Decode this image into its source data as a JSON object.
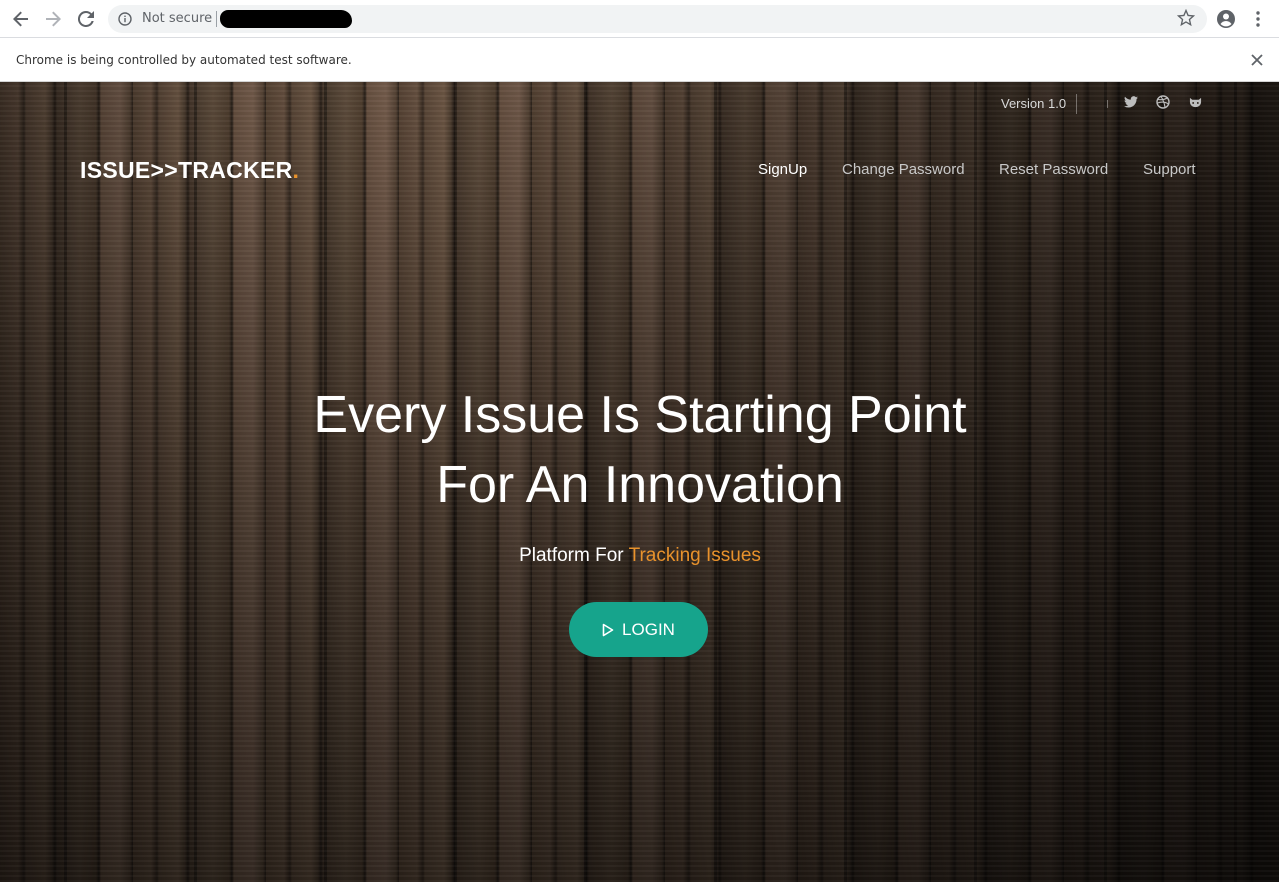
{
  "browser": {
    "not_secure_label": "Not secure",
    "infobar_text": "Chrome is being controlled by automated test software."
  },
  "site": {
    "version_label": "Version 1.0",
    "logo_text": "ISSUE>>TRACKER",
    "logo_dot": ".",
    "nav": [
      {
        "label": "SignUp",
        "active": true
      },
      {
        "label": "Change Password",
        "active": false
      },
      {
        "label": "Reset Password",
        "active": false
      },
      {
        "label": "Support",
        "active": false
      }
    ],
    "social_icons": [
      "twitter-icon",
      "dribbble-icon",
      "github-icon"
    ],
    "headline_line1": "Every Issue Is Starting Point",
    "headline_line2": "For An Innovation",
    "tagline_prefix": "Platform For ",
    "tagline_accent": "Tracking Issues",
    "login_label": "LOGIN"
  },
  "colors": {
    "accent_orange": "#e8922c",
    "button_teal": "#16a48c"
  }
}
